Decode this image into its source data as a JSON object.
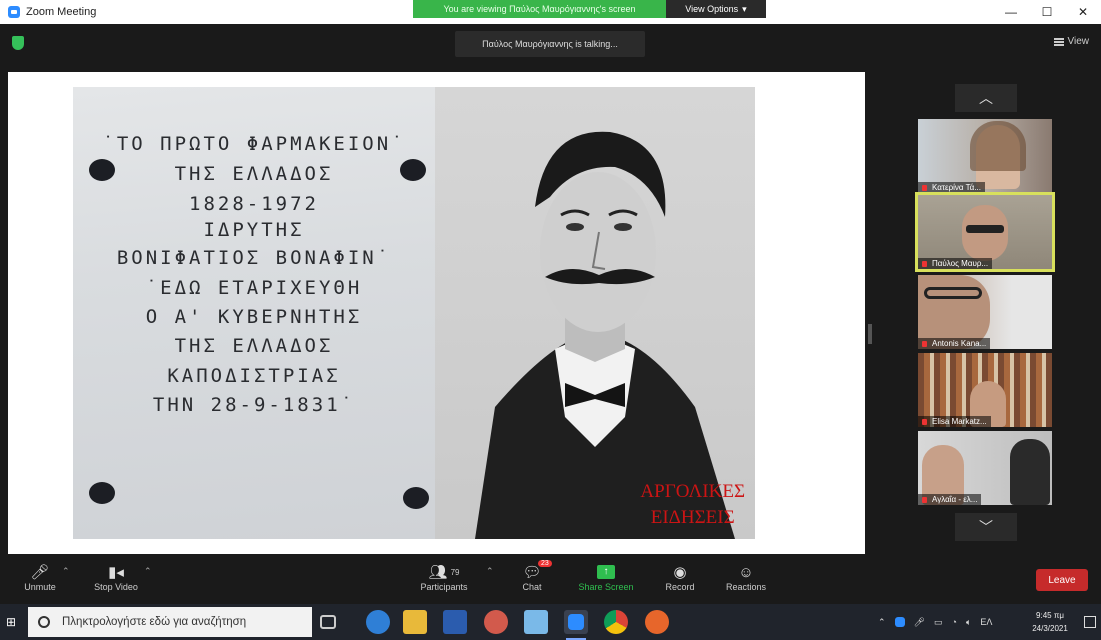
{
  "window": {
    "title": "Zoom Meeting",
    "viewing_banner": "You are viewing Παύλος Μαυρόγιαννης's screen",
    "view_options": "View Options",
    "minimize": "—",
    "maximize": "☐",
    "close": "✕"
  },
  "meeting": {
    "talking": "Παύλος Μαυρόγιαννης is talking...",
    "view_label": "View"
  },
  "shared_content": {
    "plaque_lines": [
      "˙ΤΟ ΠΡΩΤΟ ΦΑΡΜΑΚΕΙΟΝ˙",
      "ΤΗΣ ΕΛΛΑΔΟΣ",
      "1828-1972",
      "ΙΔΡΥΤΗΣ",
      "ΒΟΝΙΦΑΤΙΟΣ ΒΟΝΑΦΙΝ˙",
      "˙ΕΔΩ ΕΤΑΡΙΧΕΥΘΗ",
      "Ο Α' ΚΥΒΕΡΝΗΤΗΣ",
      "ΤΗΣ ΕΛΛΑΔΟΣ",
      "ΚΑΠΟΔΙΣΤΡΙΑΣ",
      "ΤΗΝ 28-9-1831˙"
    ],
    "watermark_line1": "ΑΡΓΟΛΙΚΕΣ",
    "watermark_line2": "ΕΙΔΗΣΕΙΣ"
  },
  "participants": [
    {
      "name": "Κατερίνα Τά...",
      "active": false
    },
    {
      "name": "Παύλος Μαυρ...",
      "active": true
    },
    {
      "name": "Antonis Kana...",
      "active": false
    },
    {
      "name": "Elisa Markatz...",
      "active": false
    },
    {
      "name": "Αγλαΐα - ελ...",
      "active": false
    }
  ],
  "toolbar": {
    "unmute": "Unmute",
    "stop_video": "Stop Video",
    "participants": "Participants",
    "participants_count": "79",
    "chat": "Chat",
    "chat_badge": "23",
    "share_screen": "Share Screen",
    "record": "Record",
    "reactions": "Reactions",
    "leave": "Leave"
  },
  "taskbar": {
    "search_placeholder": "Πληκτρολογήστε εδώ για αναζήτηση",
    "language": "ΕΛ",
    "time": "9:45 πμ",
    "date": "24/3/2021"
  },
  "colors": {
    "accent_green": "#39b54a",
    "leave_red": "#c62b2b",
    "active_speaker": "#d8e05c"
  }
}
